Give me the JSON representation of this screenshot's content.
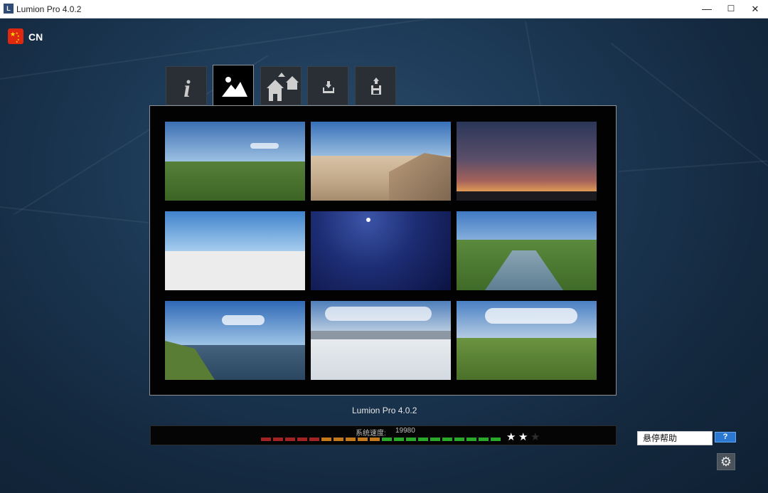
{
  "window": {
    "title": "Lumion Pro 4.0.2",
    "minimize_glyph": "—",
    "maximize_glyph": "☐",
    "close_glyph": "✕"
  },
  "language": {
    "code": "CN",
    "flag_icon": "china-flag-icon"
  },
  "tabs": [
    {
      "name": "info",
      "icon": "info-icon",
      "label": "i",
      "active": false
    },
    {
      "name": "new-scene",
      "icon": "landscape-icon",
      "active": true
    },
    {
      "name": "examples",
      "icon": "houses-icon",
      "active": false
    },
    {
      "name": "load",
      "icon": "load-icon",
      "active": false
    },
    {
      "name": "save",
      "icon": "save-icon",
      "active": false
    }
  ],
  "scenes": [
    {
      "name": "grassland"
    },
    {
      "name": "desert"
    },
    {
      "name": "sunset"
    },
    {
      "name": "white-plain"
    },
    {
      "name": "night"
    },
    {
      "name": "river-valley"
    },
    {
      "name": "lake-coast"
    },
    {
      "name": "snow-mountains"
    },
    {
      "name": "green-hills"
    }
  ],
  "version_label": "Lumion Pro 4.0.2",
  "speed": {
    "label": "系统速度:",
    "value": "19980",
    "segment_colors": [
      "#a32222",
      "#a32222",
      "#a32222",
      "#a32222",
      "#a32222",
      "#c47a1a",
      "#c47a1a",
      "#c47a1a",
      "#c47a1a",
      "#c47a1a",
      "#2aa82a",
      "#2aa82a",
      "#2aa82a",
      "#2aa82a",
      "#2aa82a",
      "#2aa82a",
      "#2aa82a",
      "#2aa82a",
      "#2aa82a",
      "#2aa82a"
    ],
    "stars_filled": 2,
    "stars_total": 3,
    "star_glyph": "★"
  },
  "hover_help": {
    "label": "悬停帮助",
    "button": "?"
  },
  "settings": {
    "glyph": "⚙"
  },
  "colors": {
    "accent_blue": "#2b78d3",
    "panel_border": "#8a9094"
  }
}
